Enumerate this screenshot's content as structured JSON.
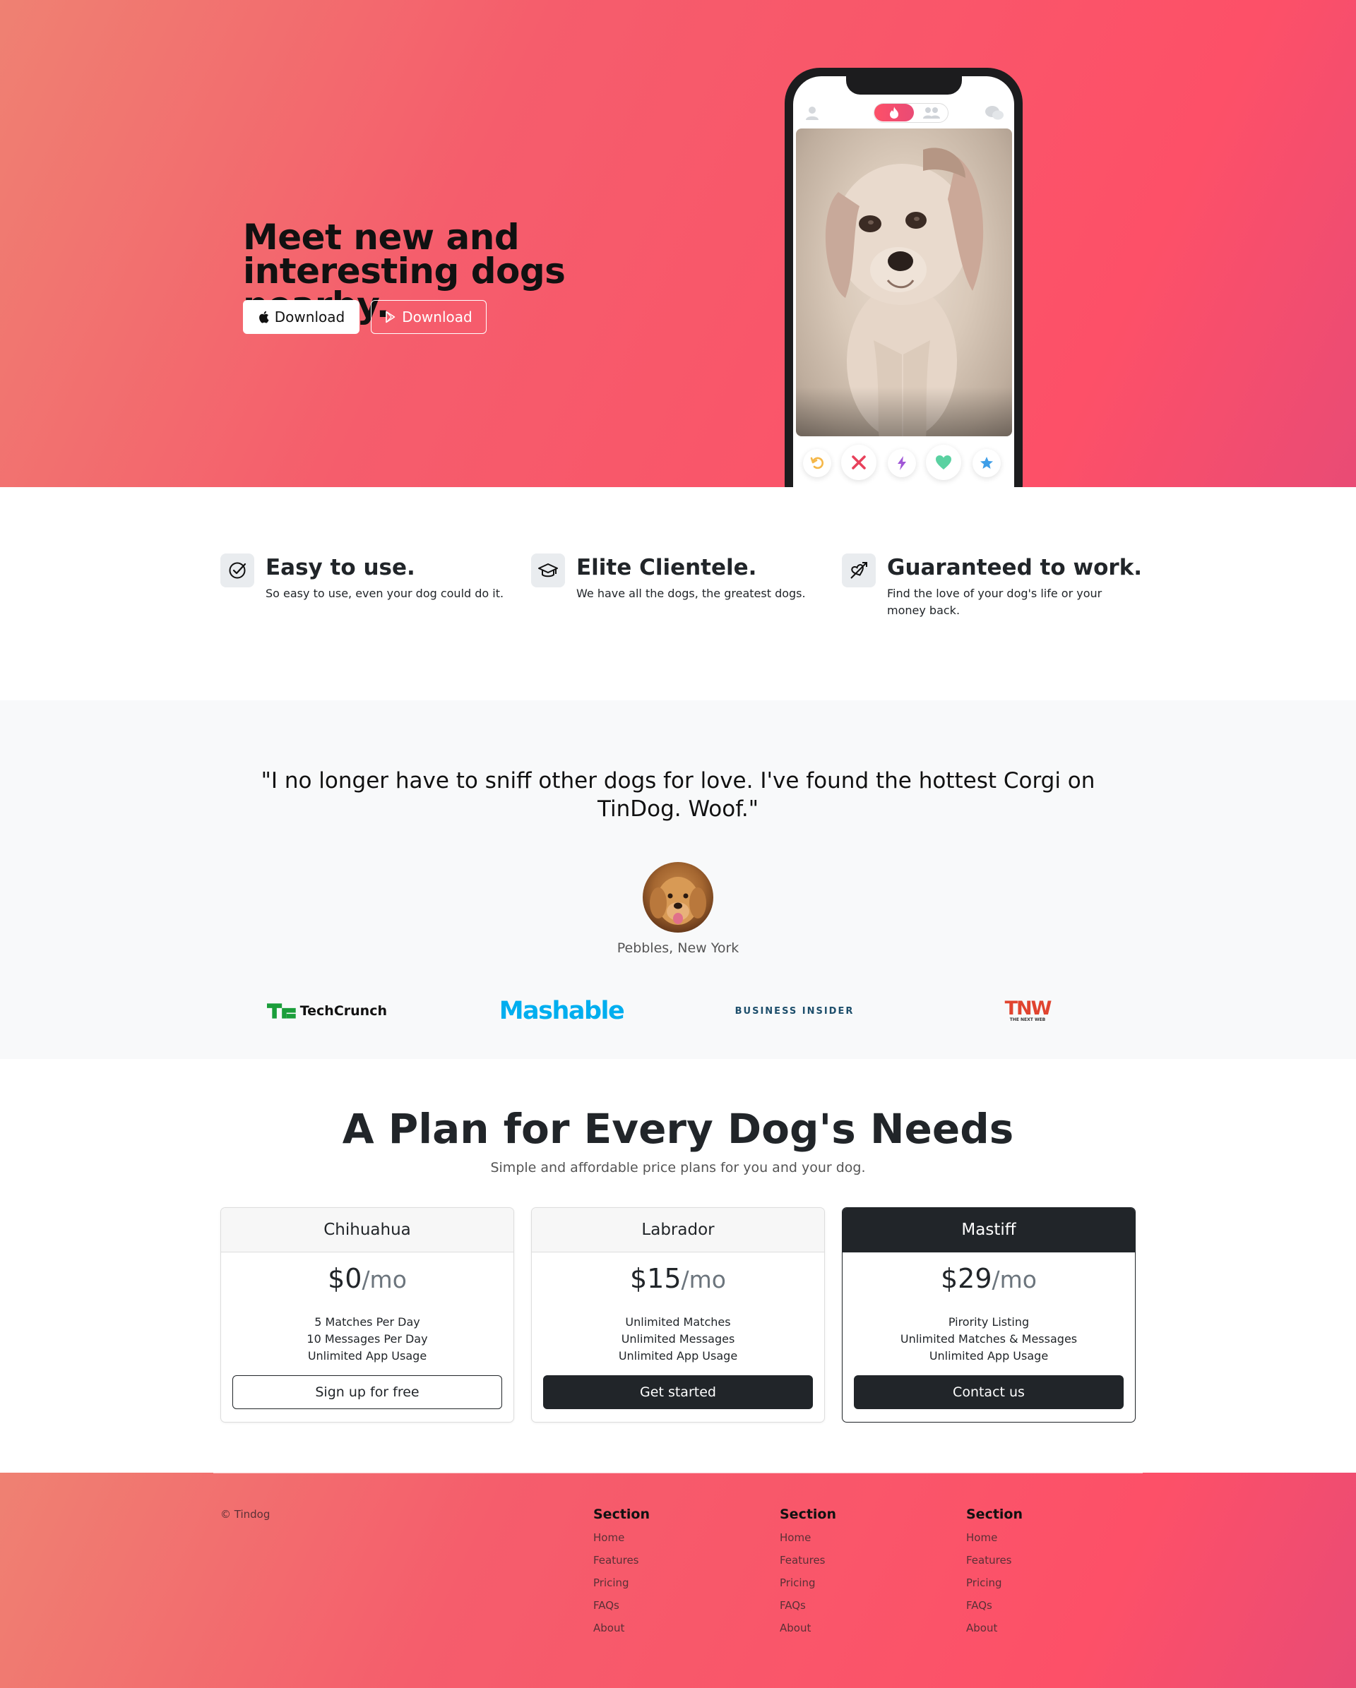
{
  "hero": {
    "title_line1": "Meet new and",
    "title_line2": "interesting dogs nearby.",
    "btn_apple": "Download",
    "btn_play": "Download"
  },
  "phone": {
    "icons": [
      "user-icon",
      "flame-icon",
      "friends-icon",
      "chat-icon"
    ],
    "actions": [
      "rewind-icon",
      "nope-icon",
      "boost-icon",
      "like-icon",
      "super-like-icon"
    ]
  },
  "features": [
    {
      "title": "Easy to use.",
      "text": "So easy to use, even your dog could do it.",
      "icon": "check-circle-icon"
    },
    {
      "title": "Elite Clientele.",
      "text": "We have all the dogs, the greatest dogs.",
      "icon": "graduation-cap-icon"
    },
    {
      "title": "Guaranteed to work.",
      "text": "Find the love of your dog's life or your money back.",
      "icon": "heart-arrow-icon"
    }
  ],
  "testimonial": {
    "quote": "\"I no longer have to sniff other dogs for love. I've found the hottest Corgi on TinDog. Woof.\"",
    "name": "Pebbles, New York"
  },
  "press": {
    "techcrunch": "TechCrunch",
    "mashable": "Mashable",
    "business_insider": "BUSINESS INSIDER",
    "tnw": "TNW",
    "tnw_sub": "THE NEXT WEB"
  },
  "pricing": {
    "title": "A Plan for Every Dog's Needs",
    "subtitle": "Simple and affordable price plans for you and your dog.",
    "plans": [
      {
        "name": "Chihuahua",
        "price": "$0",
        "per": "/mo",
        "features": [
          "5 Matches Per Day",
          "10 Messages Per Day",
          "Unlimited App Usage"
        ],
        "cta": "Sign up for free"
      },
      {
        "name": "Labrador",
        "price": "$15",
        "per": "/mo",
        "features": [
          "Unlimited Matches",
          "Unlimited Messages",
          "Unlimited App Usage"
        ],
        "cta": "Get started"
      },
      {
        "name": "Mastiff",
        "price": "$29",
        "per": "/mo",
        "features": [
          "Pirority Listing",
          "Unlimited Matches & Messages",
          "Unlimited App Usage"
        ],
        "cta": "Contact us"
      }
    ]
  },
  "footer": {
    "copyright": "© Tindog",
    "columns": [
      {
        "title": "Section",
        "links": [
          "Home",
          "Features",
          "Pricing",
          "FAQs",
          "About"
        ]
      },
      {
        "title": "Section",
        "links": [
          "Home",
          "Features",
          "Pricing",
          "FAQs",
          "About"
        ]
      },
      {
        "title": "Section",
        "links": [
          "Home",
          "Features",
          "Pricing",
          "FAQs",
          "About"
        ]
      }
    ]
  },
  "colors": {
    "brand": "#fd5068",
    "gradient_start": "#ef8172",
    "dark": "#212529",
    "light_bg": "#f8f9fa"
  }
}
